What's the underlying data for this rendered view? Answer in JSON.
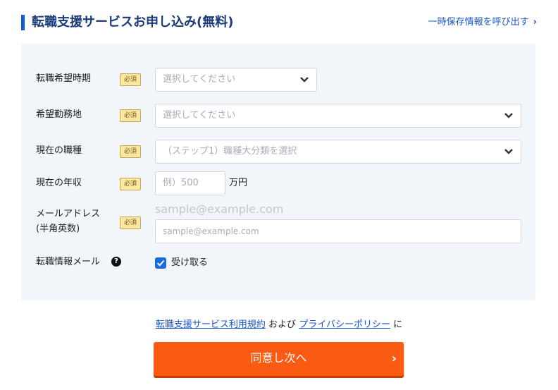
{
  "header": {
    "title": "転職支援サービスお申し込み(無料)",
    "save_link": "一時保存情報を呼び出す"
  },
  "form": {
    "required_badge": "必須",
    "fields": {
      "timing": {
        "label": "転職希望時期",
        "placeholder": "選択してください"
      },
      "location": {
        "label": "希望勤務地",
        "placeholder": "選択してください"
      },
      "job": {
        "label": "現在の職種",
        "placeholder": "（ステップ1）職種大分類を選択"
      },
      "income": {
        "label": "現在の年収",
        "placeholder": "例）500",
        "suffix": "万円"
      },
      "email": {
        "label_line1": "メールアドレス",
        "label_line2": "(半角英数)",
        "ghost": "sample@example.com",
        "placeholder": "sample@example.com"
      },
      "newsletter": {
        "label": "転職情報メール",
        "help": "?",
        "checkbox_label": "受け取る",
        "checked": true
      }
    }
  },
  "terms": {
    "link1": "転職支援サービス利用規約",
    "middle": "および",
    "link2": "プライバシーポリシー",
    "end": "に"
  },
  "cta": {
    "label": "同意し次へ",
    "arrow": "›"
  },
  "colors": {
    "accent": "#1a56c4",
    "cta": "#fa5a12",
    "panel": "#f2f5f9",
    "badge": "#fbe7a6"
  }
}
